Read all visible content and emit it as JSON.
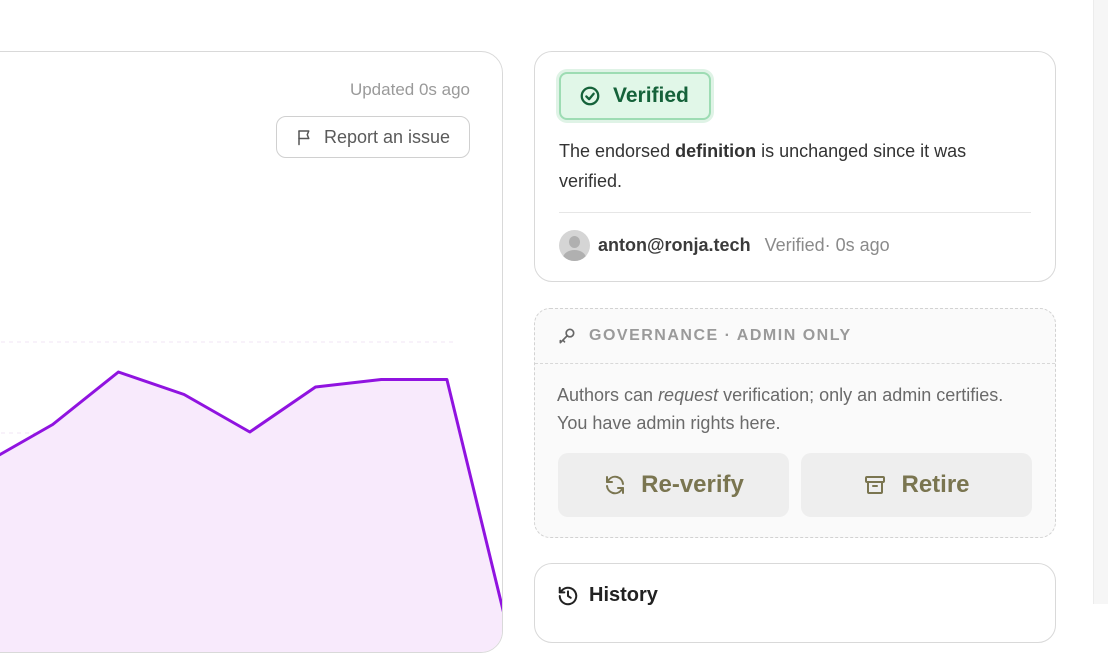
{
  "chart_panel": {
    "updated_label": "Updated 0s ago",
    "report_button_label": "Report an issue"
  },
  "chart_data": {
    "type": "area",
    "series": [
      {
        "values": [
          58,
          63,
          70,
          67,
          62,
          68,
          69,
          69,
          33
        ]
      }
    ],
    "colors": {
      "line": "#9013e0",
      "fill": "#f8eafc"
    }
  },
  "verification": {
    "badge_label": "Verified",
    "message_part1": "The endorsed ",
    "message_bold": "definition",
    "message_part2": " is unchanged since it was verified.",
    "verifier_email": "anton@ronja.tech",
    "verified_time": "Verified· 0s ago",
    "colors": {
      "badge_bg": "#e1f7e8",
      "badge_text": "#15623a"
    }
  },
  "governance": {
    "header_label": "GOVERNANCE · ADMIN ONLY",
    "text_part1": "Authors can ",
    "text_italic": "request",
    "text_part2": " verification; only an admin certifies. You have admin rights here.",
    "reverify_label": "Re-verify",
    "retire_label": "Retire",
    "colors": {
      "button_text": "#7a7550",
      "button_bg": "#eeeeee"
    }
  },
  "history": {
    "title": "History"
  }
}
